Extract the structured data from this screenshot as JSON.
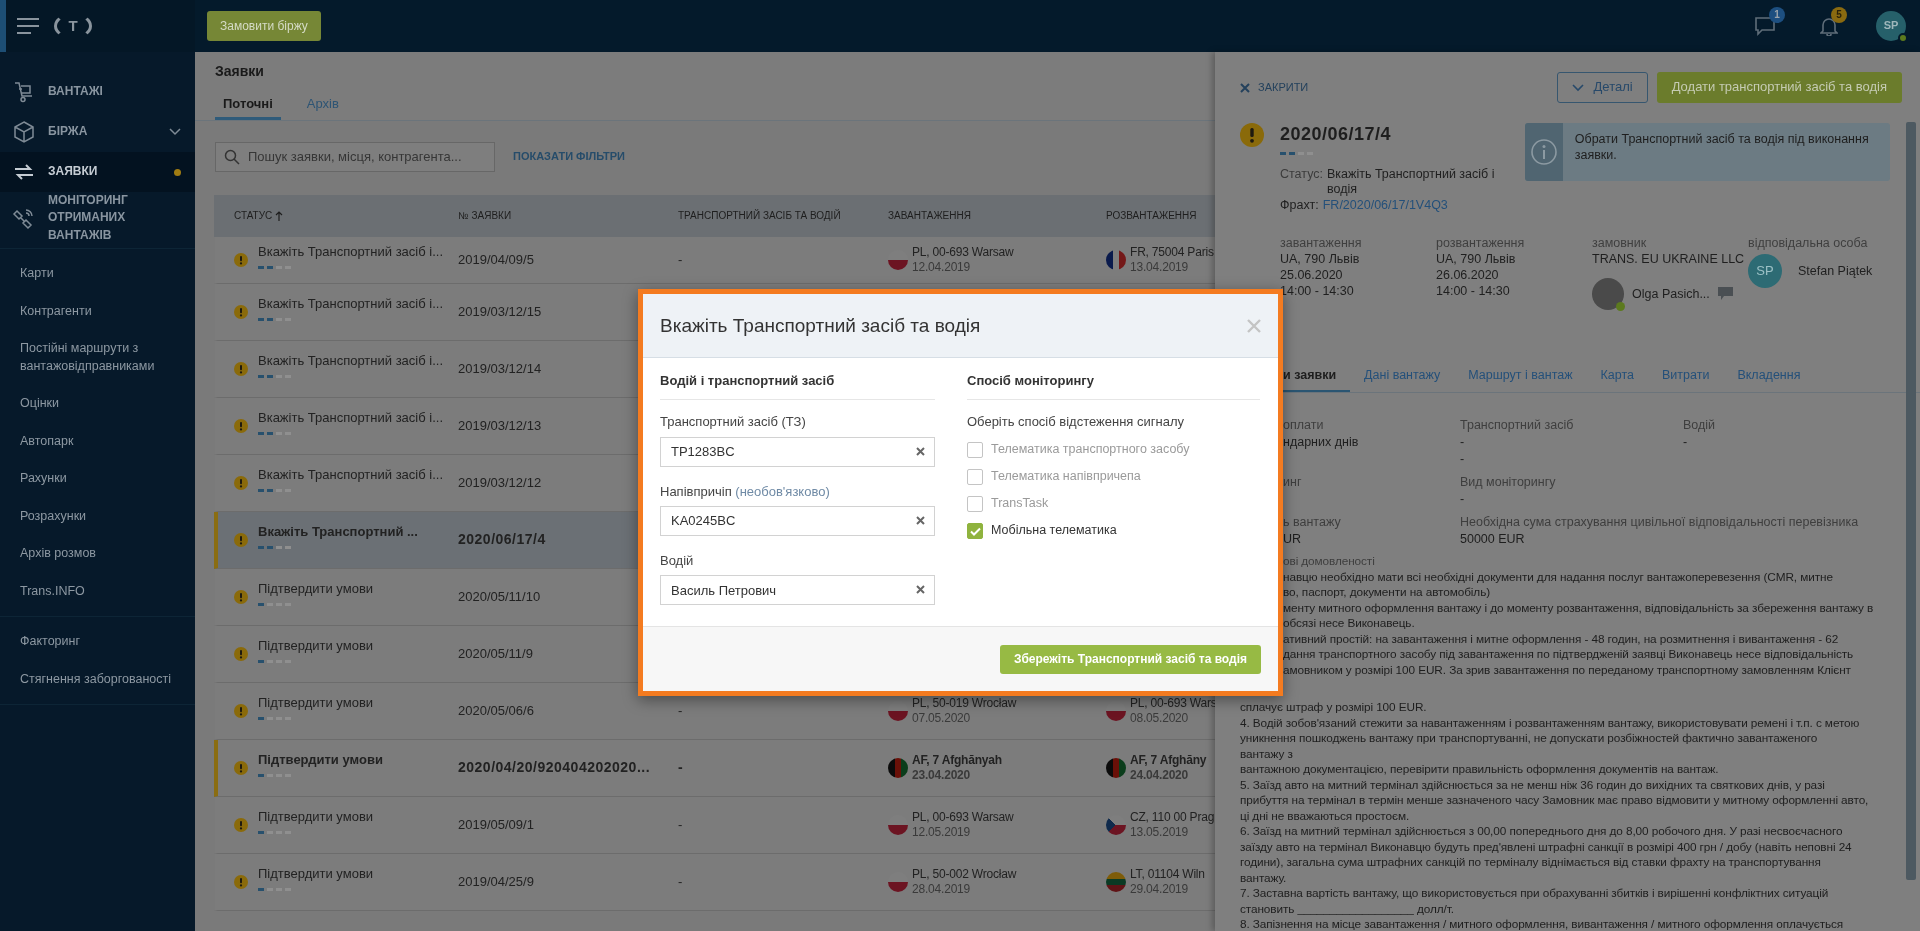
{
  "sidebar": {
    "logo": "T",
    "primary": [
      {
        "label": "ВАНТАЖІ",
        "kind": "cart",
        "selected": false,
        "has_submenu": false,
        "notification": false
      },
      {
        "label": "БІРЖА",
        "kind": "box",
        "selected": false,
        "has_submenu": true,
        "notification": false
      },
      {
        "label": "ЗАЯВКИ",
        "kind": "exchange",
        "selected": true,
        "has_submenu": false,
        "notification": true
      },
      {
        "label": "МОНІТОРИНГ ОТРИМАНИХ ВАНТАЖІВ",
        "kind": "satellite",
        "selected": false,
        "has_submenu": false,
        "notification": false
      }
    ],
    "links": [
      "Карти",
      "Контрагенти",
      "Постійні маршрути з вантажовідправниками",
      "Оцінки",
      "Автопарк",
      "Рахунки",
      "Розрахунки",
      "Архів розмов",
      "Trans.INFO"
    ],
    "extra_links": [
      "Факторинг",
      "Стягнення заборгованості"
    ]
  },
  "topbar": {
    "order_button": "Замовити біржу",
    "messages": {
      "count": "1"
    },
    "notifications": {
      "count": "5"
    },
    "user": {
      "initials": "SP",
      "online": true
    }
  },
  "list": {
    "title": "Заявки",
    "tabs": [
      {
        "label": "Поточні",
        "selected": true
      },
      {
        "label": "Архів",
        "selected": false
      }
    ],
    "search": {
      "placeholder": "Пошук заявки, місця, контрагента..."
    },
    "filters_link": "ПОКАЗАТИ ФІЛЬТРИ",
    "columns": [
      {
        "label": "СТАТУС",
        "sorted": true
      },
      {
        "label": "№ ЗАЯВКИ",
        "sorted": false
      },
      {
        "label": "ТРАНСПОРТНИЙ ЗАСІБ ТА ВОДІЙ",
        "sorted": false
      },
      {
        "label": "ЗАВАНТАЖЕННЯ",
        "sorted": false
      },
      {
        "label": "РОЗВАНТАЖЕННЯ",
        "sorted": false
      }
    ],
    "rows": [
      {
        "status": "Вкажіть Транспортний засіб і...",
        "level": 0.5,
        "number": "2019/04/09/5",
        "vehicle": "-",
        "loading": {
          "kind": "pl",
          "place": "PL, 00-693 Warsaw",
          "date": "12.04.2019"
        },
        "unloading": {
          "kind": "fr",
          "place": "FR, 75004 Paris",
          "date": "13.04.2019"
        },
        "selected": false,
        "unread": false
      },
      {
        "status": "Вкажіть Транспортний засіб і...",
        "level": 0.5,
        "number": "2019/03/12/15",
        "selected": false,
        "unread": false
      },
      {
        "status": "Вкажіть Транспортний засіб і...",
        "level": 0.5,
        "number": "2019/03/12/14",
        "selected": false,
        "unread": false
      },
      {
        "status": "Вкажіть Транспортний засіб і...",
        "level": 0.5,
        "number": "2019/03/12/13",
        "selected": false,
        "unread": false
      },
      {
        "status": "Вкажіть Транспортний засіб і...",
        "level": 0.5,
        "number": "2019/03/12/12",
        "selected": false,
        "unread": false
      },
      {
        "status": "Вкажіть Транспортний ...",
        "level": 0.5,
        "number": "2020/06/17/4",
        "selected": true,
        "unread": true
      },
      {
        "status": "Підтвердити умови",
        "level": 0.25,
        "number": "2020/05/11/10",
        "selected": false,
        "unread": false
      },
      {
        "status": "Підтвердити умови",
        "level": 0.25,
        "number": "2020/05/11/9",
        "selected": false,
        "unread": false
      },
      {
        "status": "Підтвердити умови",
        "level": 0.25,
        "number": "2020/05/06/6",
        "vehicle": "-",
        "loading": {
          "kind": "pl",
          "place": "PL, 50-019 Wrocław",
          "date": "07.05.2020"
        },
        "unloading": {
          "kind": "pl",
          "place": "PL, 00-693 Wars",
          "date": "08.05.2020"
        },
        "selected": false,
        "unread": false
      },
      {
        "status": "Підтвердити умови",
        "level": 0.25,
        "number": "2020/04/20/920404202020...",
        "vehicle": "-",
        "loading": {
          "kind": "af",
          "place": "AF, 7 Afghānyah",
          "date": "23.04.2020"
        },
        "unloading": {
          "kind": "af",
          "place": "AF, 7 Afghāny",
          "date": "24.04.2020"
        },
        "selected": false,
        "unread": true
      },
      {
        "status": "Підтвердити умови",
        "level": 0.25,
        "number": "2019/05/09/1",
        "vehicle": "-",
        "loading": {
          "kind": "pl",
          "place": "PL, 00-693 Warsaw",
          "date": "12.05.2019"
        },
        "unloading": {
          "kind": "cz",
          "place": "CZ, 110 00 Prag",
          "date": "13.05.2019"
        },
        "selected": false,
        "unread": false
      },
      {
        "status": "Підтвердити умови",
        "level": 0.25,
        "number": "2019/04/25/9",
        "vehicle": "-",
        "loading": {
          "kind": "pl",
          "place": "PL, 50-002 Wrocław",
          "date": "28.04.2019"
        },
        "unloading": {
          "kind": "lt",
          "place": "LT, 01104 Wiln",
          "date": "29.04.2019"
        },
        "selected": false,
        "unread": false
      }
    ]
  },
  "drawer": {
    "close": "ЗАКРИТИ",
    "details_button": "Деталі",
    "add_button": "Додати транспортний засіб та водія",
    "number": "2020/06/17/4",
    "level": 0.5,
    "status_label": "Статус:",
    "status": "Вкажіть Транспортний засіб і водія",
    "freight_label": "Фрахт:",
    "freight": "FR/2020/06/17/1V4Q3",
    "info": "Обрати Транспортний засіб та водія під виконання заявки.",
    "summary": [
      {
        "label": "завантаження",
        "lines": [
          "UA, 790 Львів",
          "25.06.2020",
          "14:00 - 14:30"
        ]
      },
      {
        "label": "розвантаження",
        "lines": [
          "UA, 790 Львів",
          "26.06.2020",
          "14:00 - 14:30"
        ]
      },
      {
        "label": "замовник",
        "lines": [
          "TRANS. EU UKRAINE LLC"
        ],
        "contact": {
          "name": "Olga Pasich...",
          "online": true
        }
      },
      {
        "label": "відповідальна особа",
        "person": {
          "initials": "SP",
          "name": "Stefan Piątek"
        }
      }
    ],
    "tabs": [
      {
        "label": "и заявки",
        "selected": true
      },
      {
        "label": "Дані вантажу",
        "selected": false
      },
      {
        "label": "Маршрут і вантаж",
        "selected": false
      },
      {
        "label": "Карта",
        "selected": false
      },
      {
        "label": "Витрати",
        "selected": false
      },
      {
        "label": "Вкладення",
        "selected": false
      }
    ],
    "fields": [
      {
        "cells": [
          {
            "label": "оплати",
            "values": [
              "ндарних днів"
            ]
          },
          {
            "label": "Транспортний засіб",
            "values": [
              "-",
              "-"
            ]
          },
          {
            "label": "Водій",
            "values": [
              "-"
            ]
          }
        ]
      },
      {
        "cells": [
          {
            "label": "инг"
          },
          {
            "label": "Вид моніторингу",
            "values": [
              "-"
            ]
          }
        ]
      },
      {
        "cells": [
          {
            "label": "ь вантажу",
            "values": [
              "UR"
            ]
          },
          {
            "label": "Необхідна сума страхування цивільної відповідальності перевізника",
            "values": [
              "50000 EUR"
            ]
          }
        ]
      }
    ],
    "terms": {
      "label": "ові домовленості",
      "covered_lines": [
        "навцю необхідно мати всі необхідні документи для надання послуг вантажоперевезення (CMR, митне",
        "во, паспорт, документи на автомобіль)",
        "менту митного оформлення вантажу і до моменту розвантаження, відповідальність за збереження вантажу в",
        "обсязі несе Виконавець.",
        "ативний простій: на завантаження і митне оформлення - 48 годин, на розмитнення і вивантаження - 62",
        "дання транспортного засобу під завантаження по підтвердженій заявці Виконавець несе відповідальність",
        "амовником у розмірі 100 EUR. За зрив завантаження по переданому транспортному замовленням Клієнт"
      ],
      "lines": [
        "сплачує штраф у розмірі 100 EUR.",
        "4. Водій зобов'язаний стежити за навантаженням і розвантаженням вантажу, використовувати ремені і т.п. с метою",
        "уникнення пошкоджень вантажу при транспортуванні, не допускати розбіжностей фактично завантаженого",
        "вантажу з",
        "вантажною документацією, перевірити правильність оформлення документів на вантаж.",
        "5. Заїзд авто на митний термінал здійснюється за не менш ніж 36 годин до вихідних та святкових днів, у разі",
        "прибуття на термінал в термін менше зазначеного часу Замовник має право відмовити у митному оформленні авто,",
        "ці дні не вважаються простоєм.",
        "6. Заїзд на митний термінал здійснюється з 00,00 попереднього дня до 8,00 робочого дня. У разі несвоєчасного",
        "заїзду авто на термінал Виконавцю будуть пред'явлені штрафні санкції в розмірі 400 грн / добу (навіть неповні 24",
        "години), загальна сума штрафних санкцій по терміналу віднімається від ставки фрахту на транспортування",
        "вантажу.",
        "7. Заставна вартість вантажу, що використовується при обрахуванні збитків і вирішенні конфліктних ситуацій",
        "становить __________________ долл/т.",
        "8. Запізнення на місце завантаження / митного оформлення, вивантаження / митного оформлення оплачується"
      ]
    }
  },
  "modal": {
    "title": "Вкажіть Транспортний засіб та водія",
    "vehicle_section": {
      "heading": "Водій і транспортний засіб",
      "fields": [
        {
          "label": "Транспортний засіб (ТЗ)",
          "value": "TP1283BC"
        },
        {
          "label": "Напівпричіп",
          "hint": "(необов'язково)",
          "value": "KA0245BC"
        },
        {
          "label": "Водій",
          "value": "Василь Петрович"
        }
      ]
    },
    "monitoring_section": {
      "heading": "Спосіб моніторингу",
      "prompt": "Оберіть спосіб відстеження сигналу",
      "options": [
        {
          "label": "Телематика транспортного засобу",
          "checked": false
        },
        {
          "label": "Телематика напівпричепа",
          "checked": false
        },
        {
          "label": "TransTask",
          "checked": false
        },
        {
          "label": "Мобільна телематика",
          "checked": true
        }
      ]
    },
    "save_button": "Збережіть Транспортний засіб та водія"
  }
}
